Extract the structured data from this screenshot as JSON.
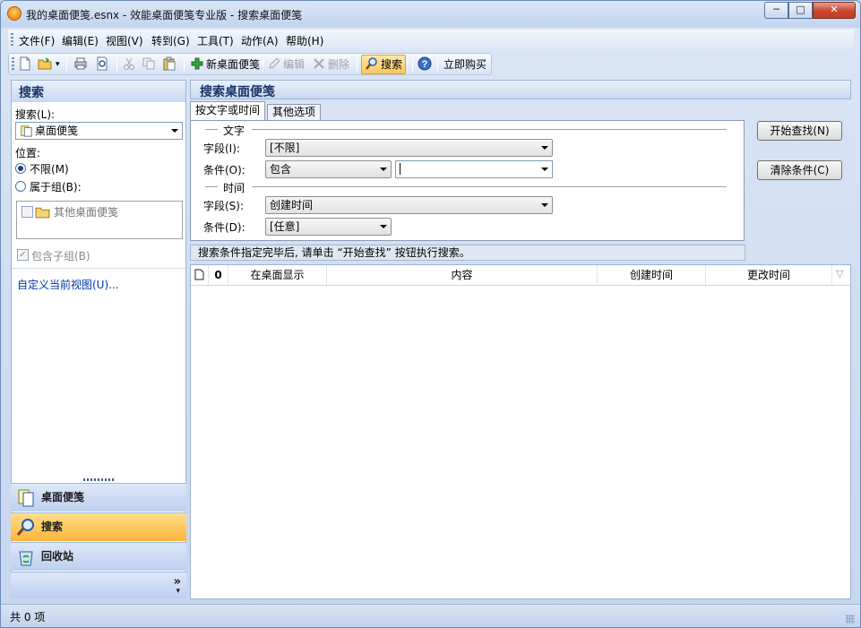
{
  "window": {
    "title": "我的桌面便笺.esnx - 效能桌面便笺专业版 - 搜索桌面便笺",
    "controls": {
      "minimize": "─",
      "maximize": "□",
      "close": "✕"
    }
  },
  "menu": [
    "文件(F)",
    "编辑(E)",
    "视图(V)",
    "转到(G)",
    "工具(T)",
    "动作(A)",
    "帮助(H)"
  ],
  "toolbar": {
    "new_note": "新桌面便笺",
    "edit": "编辑",
    "delete": "删除",
    "search": "搜索",
    "buy": "立即购买"
  },
  "left": {
    "header": "搜索",
    "search_label": "搜索(L):",
    "search_value": "桌面便笺",
    "location_label": "位置:",
    "opt_all": "不限(M)",
    "opt_group": "属于组(B):",
    "group_item": "其他桌面便笺",
    "include_sub": "包含子组(B)",
    "customize_view": "自定义当前视图(U)..."
  },
  "nav": {
    "notes": "桌面便笺",
    "search": "搜索",
    "recycle": "回收站"
  },
  "right": {
    "header": "搜索桌面便笺",
    "tab_text": "按文字或时间",
    "tab_other": "其他选项",
    "group_text": "文字",
    "field_label": "字段(I):",
    "field_value": "[不限]",
    "cond_label": "条件(O):",
    "cond_value": "包含",
    "cond_input": "",
    "group_time": "时间",
    "time_field_label": "字段(S):",
    "time_field_value": "创建时间",
    "time_cond_label": "条件(D):",
    "time_cond_value": "[任意]",
    "btn_start": "开始查找(N)",
    "btn_clear": "清除条件(C)",
    "hint": "搜索条件指定完毕后, 请单击 “开始查找” 按钮执行搜索。"
  },
  "grid": {
    "columns": [
      "在桌面显示",
      "内容",
      "创建时间",
      "更改时间"
    ]
  },
  "status": {
    "count": "共 0 项"
  }
}
